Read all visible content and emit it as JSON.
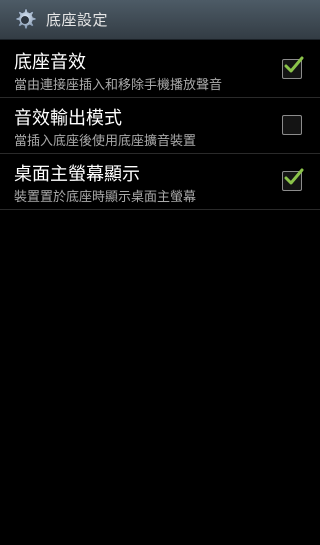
{
  "action_bar": {
    "title": "底座設定",
    "icon": "gear-icon"
  },
  "settings": [
    {
      "title": "底座音效",
      "summary": "當由連接座插入和移除手機播放聲音",
      "checked": true
    },
    {
      "title": "音效輸出模式",
      "summary": "當插入底座後使用底座擴音裝置",
      "checked": false
    },
    {
      "title": "桌面主螢幕顯示",
      "summary": "裝置置於底座時顯示桌面主螢幕",
      "checked": true
    }
  ],
  "colors": {
    "check_mark": "#8bc34a",
    "background": "#000000",
    "summary_text": "#a9a9a9"
  }
}
